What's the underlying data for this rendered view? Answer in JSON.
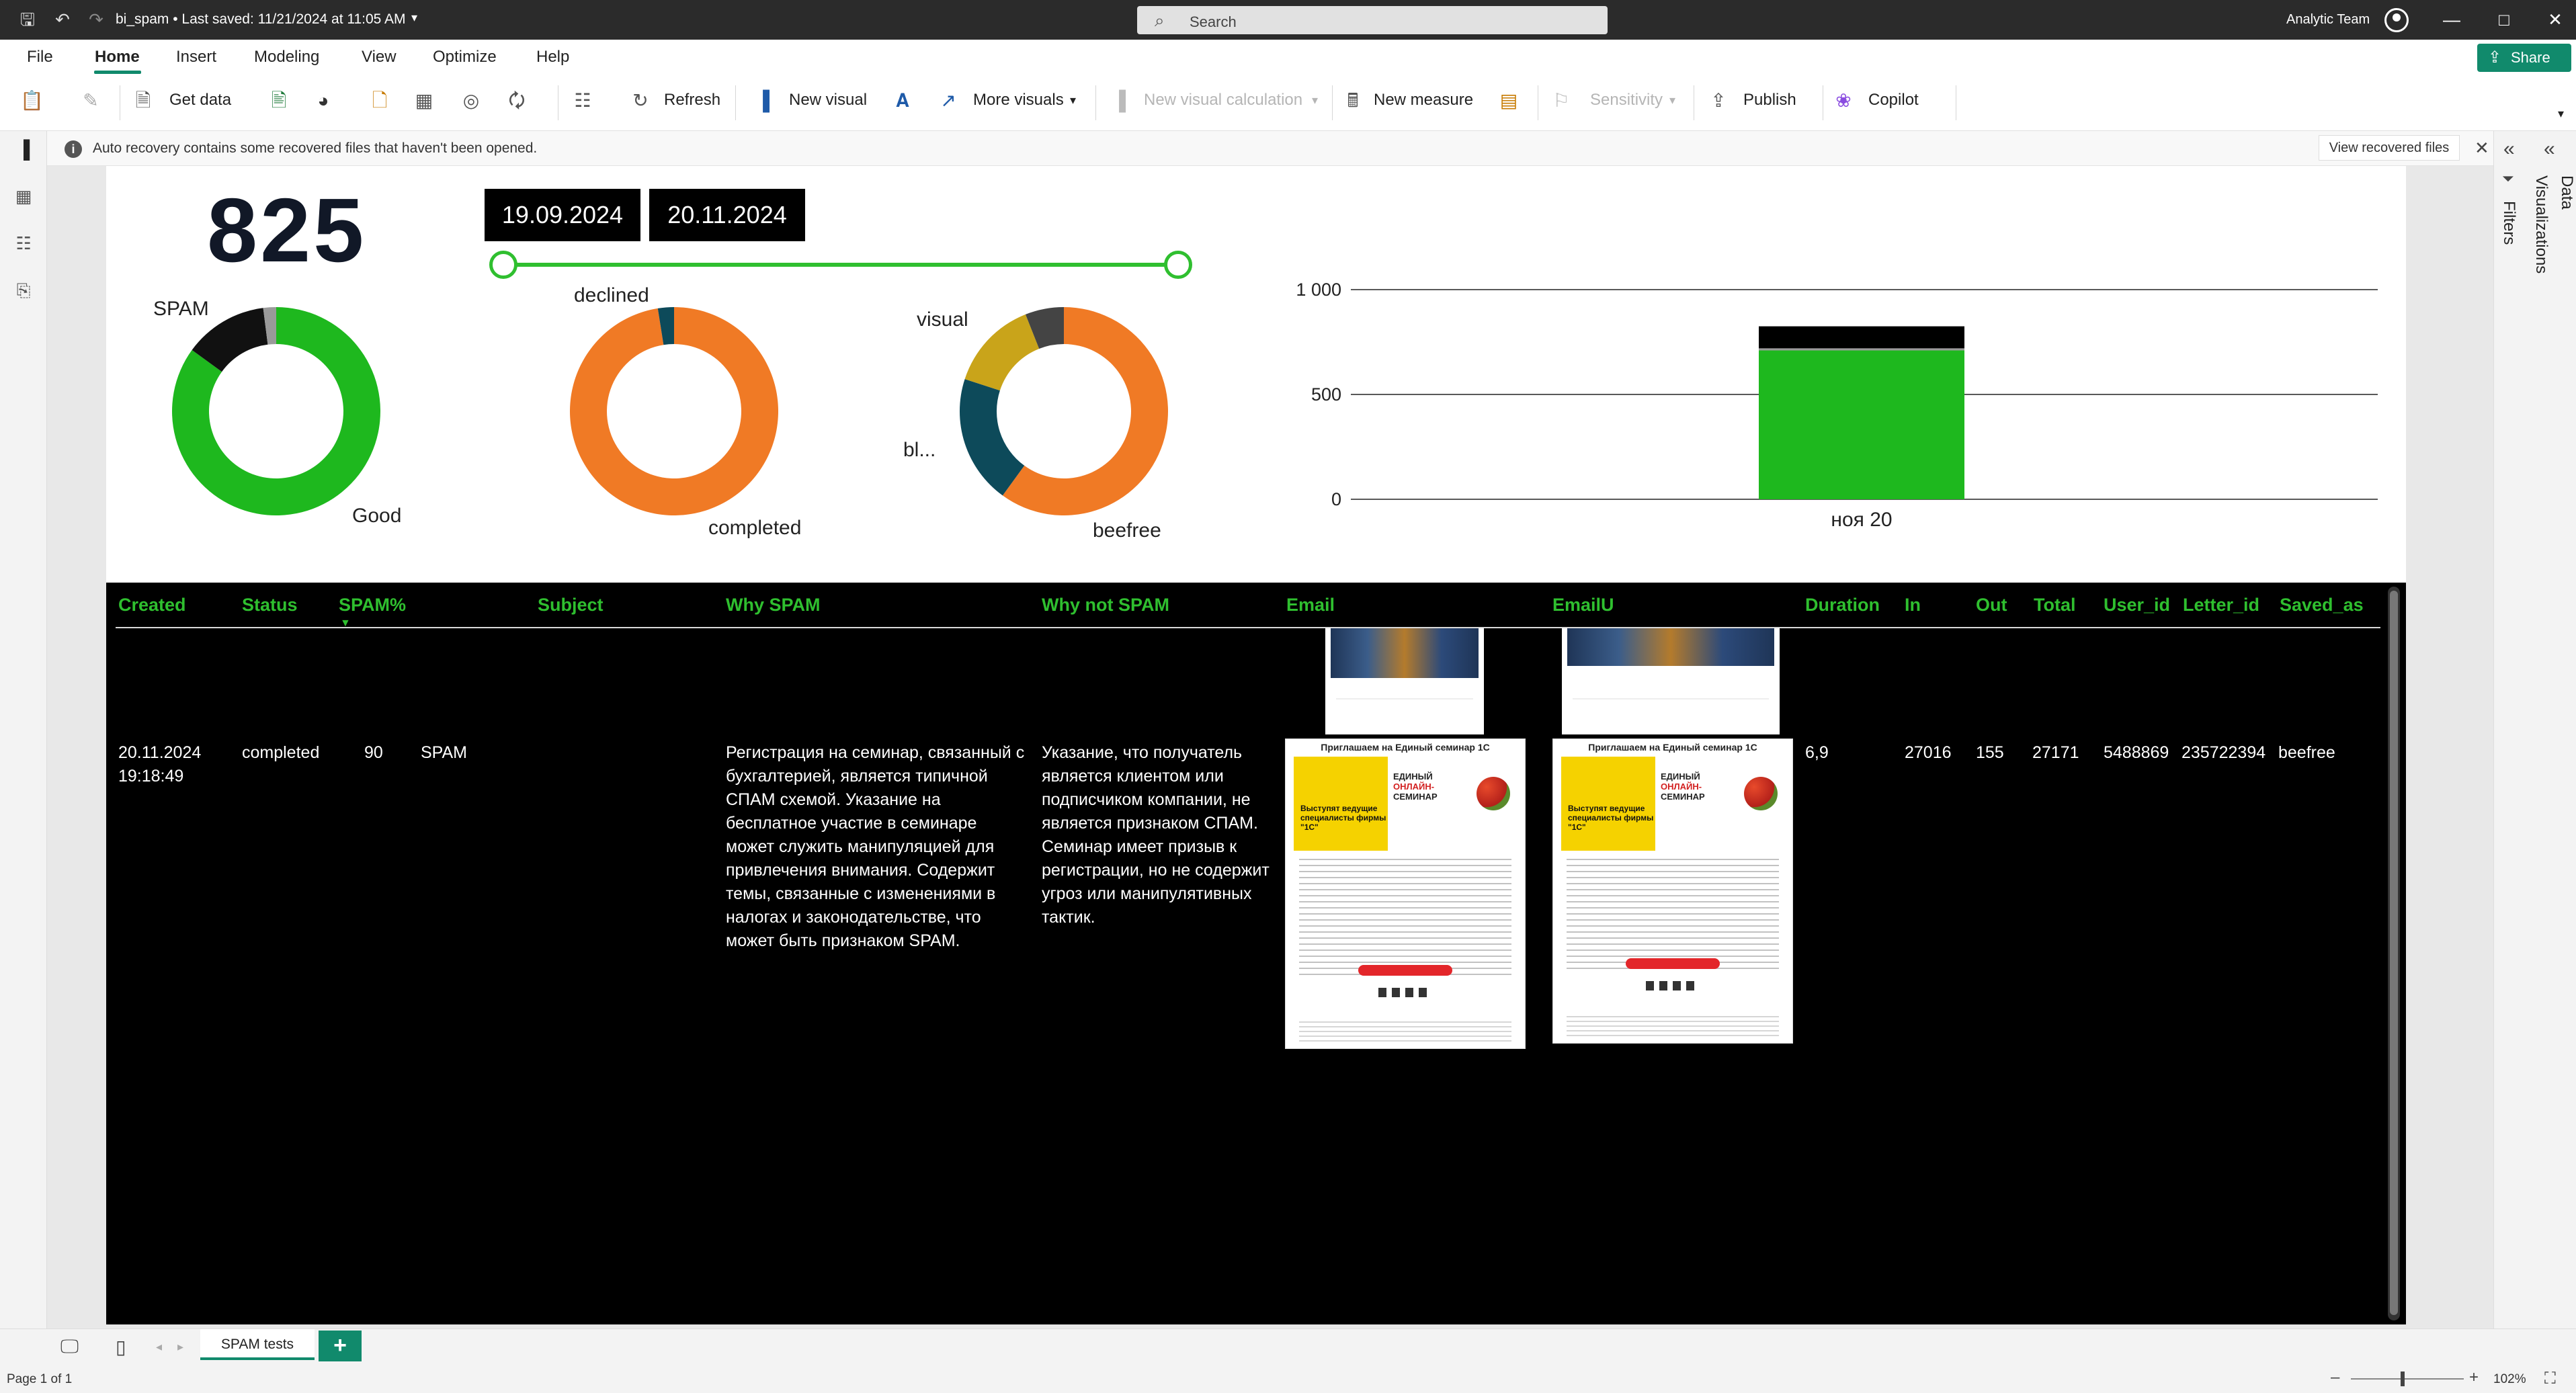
{
  "titlebar": {
    "file_title": "bi_spam • Last saved: 11/21/2024 at 11:05 AM",
    "search_placeholder": "Search",
    "user_name": "Analytic Team"
  },
  "menu": {
    "items": [
      "File",
      "Home",
      "Insert",
      "Modeling",
      "View",
      "Optimize",
      "Help"
    ],
    "active": "Home",
    "share_label": "Share"
  },
  "ribbon": {
    "get_data": "Get data",
    "refresh": "Refresh",
    "new_visual": "New visual",
    "more_visuals": "More visuals",
    "new_visual_calculation": "New visual calculation",
    "new_measure": "New measure",
    "sensitivity": "Sensitivity",
    "publish": "Publish",
    "copilot": "Copilot"
  },
  "infobar": {
    "message": "Auto recovery contains some recovered files that haven't been opened.",
    "button": "View recovered files"
  },
  "panes": {
    "filters": "Filters",
    "visualizations": "Visualizations",
    "data": "Data"
  },
  "report": {
    "kpi_value": "825",
    "date_from": "19.09.2024",
    "date_to": "20.11.2024",
    "donut_spam": {
      "label_top": "SPAM",
      "label_bottom": "Good"
    },
    "donut_status": {
      "label_top": "declined",
      "label_bottom": "completed"
    },
    "donut_saved": {
      "label_top": "visual",
      "label_mid": "bl...",
      "label_bottom": "beefree"
    }
  },
  "chart_data": [
    {
      "type": "pie",
      "variant": "donut",
      "slices": [
        {
          "label": "Good",
          "value": 0.85,
          "color": "#1eb81e"
        },
        {
          "label": "SPAM",
          "value": 0.13,
          "color": "#111111"
        },
        {
          "label": "",
          "value": 0.02,
          "color": "#9a9a9a"
        }
      ]
    },
    {
      "type": "pie",
      "variant": "donut",
      "slices": [
        {
          "label": "completed",
          "value": 0.975,
          "color": "#f07a25"
        },
        {
          "label": "declined",
          "value": 0.025,
          "color": "#0d4a5a"
        }
      ]
    },
    {
      "type": "pie",
      "variant": "donut",
      "slices": [
        {
          "label": "beefree",
          "value": 0.6,
          "color": "#f07a25"
        },
        {
          "label": "bl...",
          "value": 0.2,
          "color": "#0d4a5a"
        },
        {
          "label": "visual",
          "value": 0.14,
          "color": "#c9a41a"
        },
        {
          "label": "",
          "value": 0.06,
          "color": "#444444"
        }
      ]
    },
    {
      "type": "bar",
      "stacked": true,
      "categories": [
        "ноя 20"
      ],
      "series": [
        {
          "values": [
            710
          ],
          "color": "#1eb81e"
        },
        {
          "values": [
            10
          ],
          "color": "#9a9a9a"
        },
        {
          "values": [
            105
          ],
          "color": "#000000"
        }
      ],
      "ylim": [
        0,
        1000
      ],
      "yticks": [
        "0",
        "500",
        "1 000"
      ],
      "grid": true
    }
  ],
  "table": {
    "columns": [
      "Created",
      "Status",
      "SPAM%",
      "Subject",
      "Why SPAM",
      "Why not SPAM",
      "Email",
      "EmailU",
      "Duration",
      "In",
      "Out",
      "Total",
      "User_id",
      "Letter_id",
      "Saved_as"
    ],
    "row": {
      "created": "20.11.2024 19:18:49",
      "status": "completed",
      "spam_pct": "90",
      "subject": "SPAM",
      "why_spam": "Регистрация на семинар, связанный с бухгалтерией, является типичной СПАМ схемой. Указание на бесплатное участие в семинаре может служить манипуляцией для привлечения внимания. Содержит темы, связанные с изменениями в налогах и законодательстве, что может быть признаком SPAM.",
      "why_not_spam": "Указание, что получатель является клиентом или подписчиком компании, не является признаком СПАМ. Семинар имеет призыв к регистрации, но не содержит угроз или манипулятивных тактик.",
      "duration": "6,9",
      "in": "27016",
      "out": "155",
      "total": "27171",
      "user_id": "5488869",
      "letter_id": "235722394",
      "saved_as": "beefree"
    },
    "email_preview": {
      "heading": "Приглашаем на Единый семинар 1С",
      "banner_text": "Выступят ведущие специалисты фирмы \"1С\"",
      "title_line1": "ЕДИНЫЙ",
      "title_line2": "ОНЛАЙН-",
      "title_line3": "СЕМИНАР"
    }
  },
  "pages": {
    "tab": "SPAM tests"
  },
  "status": {
    "page_count": "Page 1 of 1",
    "zoom": "102%"
  }
}
